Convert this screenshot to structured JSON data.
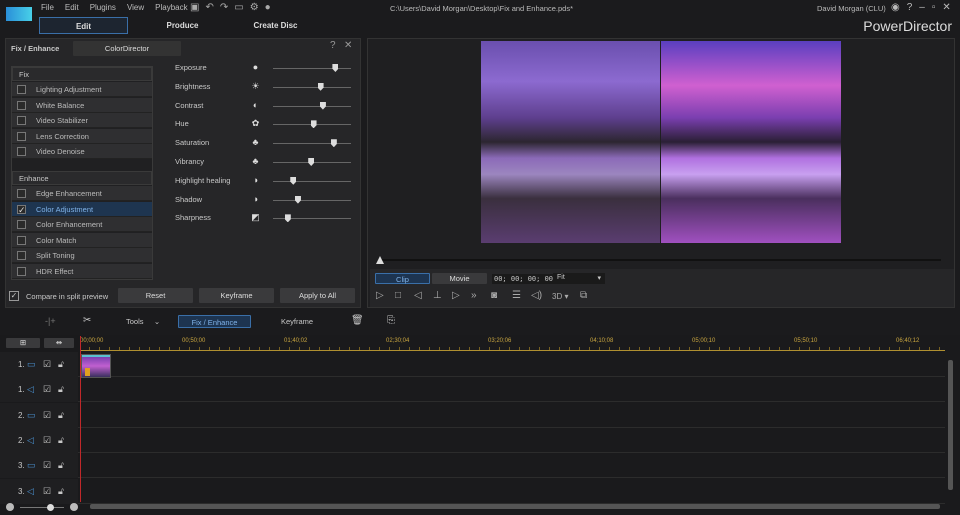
{
  "app": {
    "title": "PowerDirector",
    "file_path": "C:\\Users\\David Morgan\\Desktop\\Fix and Enhance.pds*",
    "user": "David Morgan (CLU)"
  },
  "menu": [
    "File",
    "Edit",
    "Plugins",
    "View",
    "Playback"
  ],
  "tabs": [
    "Edit",
    "Produce",
    "Create Disc"
  ],
  "panel": {
    "title": "Fix / Enhance",
    "colordirector": "ColorDirector",
    "fix_header": "Fix",
    "fix_items": [
      {
        "label": "Lighting Adjustment",
        "checked": false
      },
      {
        "label": "White Balance",
        "checked": false
      },
      {
        "label": "Video Stabilizer",
        "checked": false
      },
      {
        "label": "Lens Correction",
        "checked": false
      },
      {
        "label": "Video Denoise",
        "checked": false
      }
    ],
    "enhance_header": "Enhance",
    "enhance_items": [
      {
        "label": "Edge Enhancement",
        "checked": false
      },
      {
        "label": "Color Adjustment",
        "checked": true
      },
      {
        "label": "Color Enhancement",
        "checked": false
      },
      {
        "label": "Color Match",
        "checked": false
      },
      {
        "label": "Split Toning",
        "checked": false
      },
      {
        "label": "HDR Effect",
        "checked": false
      }
    ],
    "sliders": [
      {
        "label": "Exposure",
        "icon": "●",
        "value": 0.8
      },
      {
        "label": "Brightness",
        "icon": "☀",
        "value": 0.61
      },
      {
        "label": "Contrast",
        "icon": "◐",
        "value": 0.64
      },
      {
        "label": "Hue",
        "icon": "✿",
        "value": 0.52
      },
      {
        "label": "Saturation",
        "icon": "♣",
        "value": 0.78
      },
      {
        "label": "Vibrancy",
        "icon": "♣",
        "value": 0.49
      },
      {
        "label": "Highlight healing",
        "icon": "◑",
        "value": 0.26
      },
      {
        "label": "Shadow",
        "icon": "◑",
        "value": 0.32
      },
      {
        "label": "Sharpness",
        "icon": "◩",
        "value": 0.19
      }
    ],
    "compare_label": "Compare in split preview",
    "reset": "Reset",
    "keyframe": "Keyframe",
    "apply_all": "Apply to All"
  },
  "preview": {
    "clip": "Clip",
    "movie": "Movie",
    "timecode": "00; 00; 00; 00",
    "fit": "Fit",
    "three_d": "3D"
  },
  "toolbar": {
    "tools": "Tools",
    "fix_enhance": "Fix / Enhance",
    "keyframe": "Keyframe"
  },
  "ruler": [
    "00;00;00",
    "00;50;00",
    "01;40;02",
    "02;30;04",
    "03;20;06",
    "04;10;08",
    "05;00;10",
    "05;50;10",
    "06;40;12"
  ],
  "tracks": [
    {
      "num": "1.",
      "type": "video"
    },
    {
      "num": "1.",
      "type": "audio"
    },
    {
      "num": "2.",
      "type": "video"
    },
    {
      "num": "2.",
      "type": "audio"
    },
    {
      "num": "3.",
      "type": "video"
    },
    {
      "num": "3.",
      "type": "audio"
    }
  ]
}
